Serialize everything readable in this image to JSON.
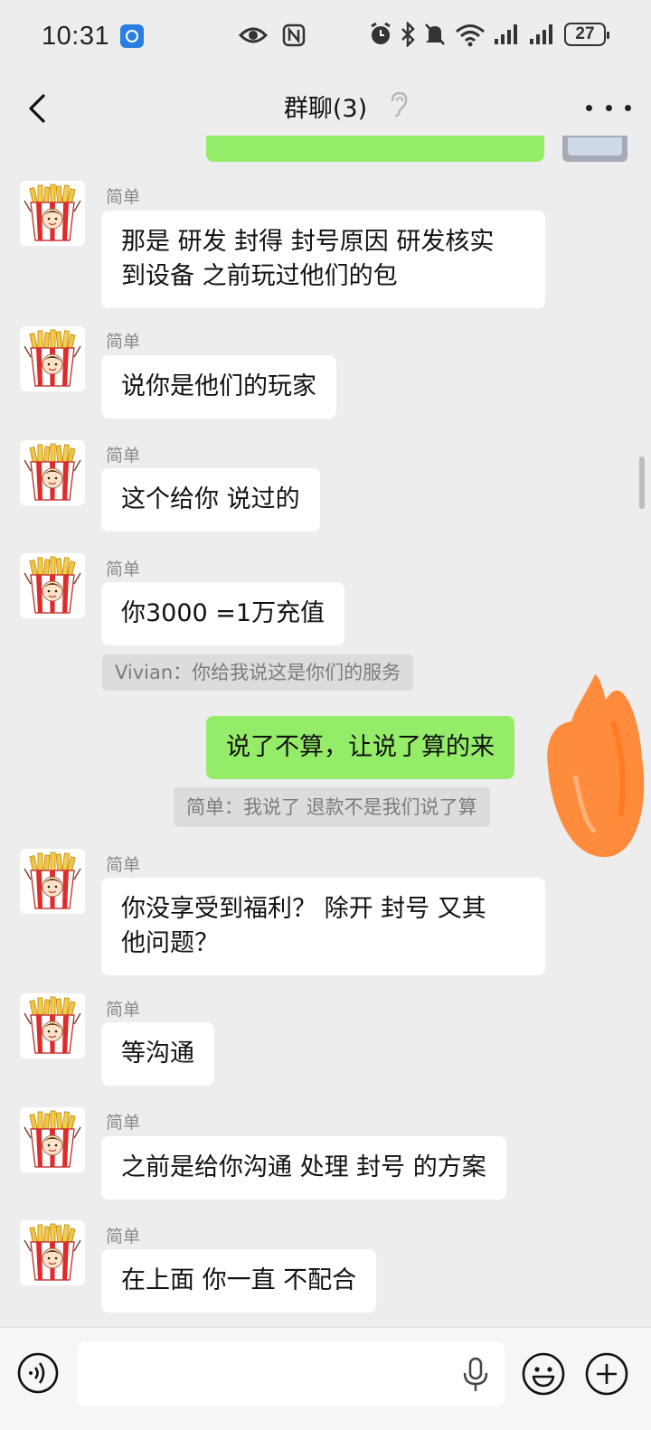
{
  "status_bar": {
    "time": "10:31",
    "battery": "27",
    "icons": [
      "app-notification-icon",
      "eye-icon",
      "nfc-icon",
      "alarm-icon",
      "bluetooth-icon",
      "mute-icon",
      "wifi-icon",
      "signal-icon",
      "signal-icon",
      "battery-icon"
    ]
  },
  "header": {
    "title": "群聊(3)",
    "icons": [
      "back-icon",
      "ear-icon",
      "more-icon"
    ]
  },
  "messages": [
    {
      "sender": "简单",
      "text_lines": [
        "那是 研发 封得 封号原因  研发核实",
        "到设备 之前玩过他们的包"
      ]
    },
    {
      "sender": "简单",
      "text": "说你是他们的玩家"
    },
    {
      "sender": "简单",
      "text": "这个给你 说过的"
    },
    {
      "sender": "简单",
      "text": "你3000 =1万充值",
      "quote": "Vivian：你给我说这是你们的服务"
    },
    {
      "self": true,
      "text": "说了不算，让说了算的来",
      "quote": "简单：我说了 退款不是我们说了算"
    },
    {
      "sender": "简单",
      "text_lines": [
        "你没享受到福利？   除开 封号 又其",
        "他问题？"
      ]
    },
    {
      "sender": "简单",
      "text": "等沟通"
    },
    {
      "sender": "简单",
      "text": "之前是给你沟通 处理 封号 的方案"
    },
    {
      "sender": "简单",
      "text": "在上面 你一直 不配合"
    }
  ],
  "input_bar": {
    "placeholder": "",
    "icons": [
      "voice-icon",
      "microphone-icon",
      "emoji-icon",
      "plus-icon"
    ]
  },
  "colors": {
    "self_bubble": "#95ec69",
    "other_bubble": "#ffffff",
    "background": "#ededed",
    "scribble": "#ff8c3c"
  }
}
